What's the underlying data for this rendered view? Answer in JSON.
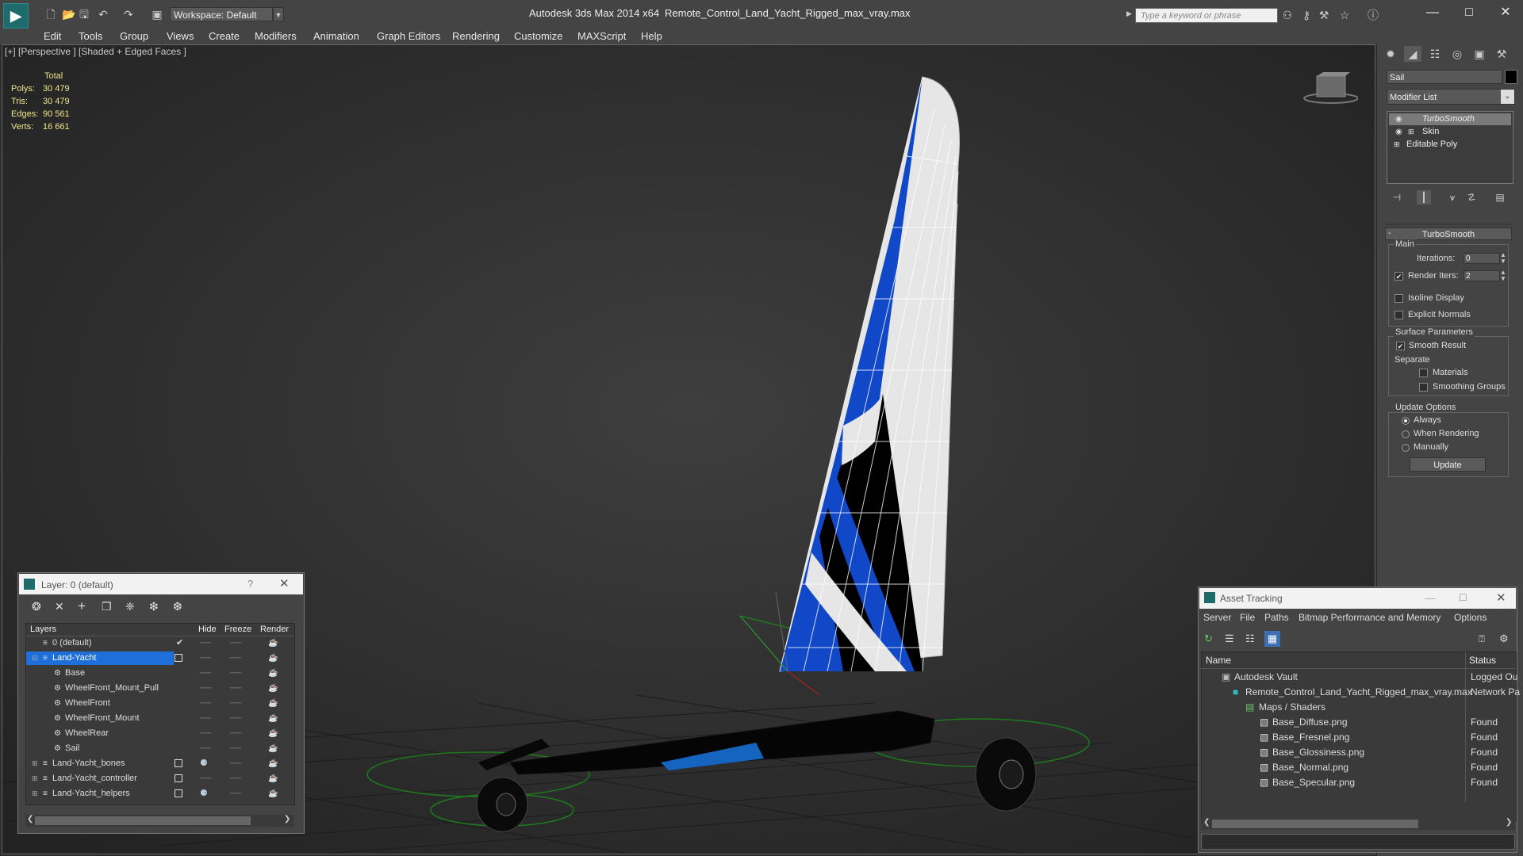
{
  "titlebar": {
    "app_title": "Autodesk 3ds Max  2014 x64",
    "file_title": "Remote_Control_Land_Yacht_Rigged_max_vray.max",
    "workspace_label": "Workspace: Default",
    "search_placeholder": "Type a keyword or phrase"
  },
  "menu": [
    "Edit",
    "Tools",
    "Group",
    "Views",
    "Create",
    "Modifiers",
    "Animation",
    "Graph Editors",
    "Rendering",
    "Customize",
    "MAXScript",
    "Help"
  ],
  "viewport": {
    "label": "[+] [Perspective ] [Shaded + Edged Faces ]",
    "stats": {
      "header": "Total",
      "rows": [
        {
          "label": "Polys:",
          "value": "30 479"
        },
        {
          "label": "Tris:",
          "value": "30 479"
        },
        {
          "label": "Edges:",
          "value": "90 561"
        },
        {
          "label": "Verts:",
          "value": "16 661"
        }
      ]
    }
  },
  "command_panel": {
    "object_name": "Sail",
    "object_color": "#000000",
    "modifier_list_label": "Modifier List",
    "stack": [
      "TurboSmooth",
      "Skin",
      "Editable Poly"
    ],
    "rollout_title": "TurboSmooth",
    "main_group": "Main",
    "iterations_label": "Iterations:",
    "iterations_value": "0",
    "render_iters_label": "Render Iters:",
    "render_iters_value": "2",
    "isoline_label": "Isoline Display",
    "explicit_normals_label": "Explicit Normals",
    "surface_params_label": "Surface Parameters",
    "smooth_result_label": "Smooth Result",
    "separate_label": "Separate",
    "materials_label": "Materials",
    "smoothing_groups_label": "Smoothing Groups",
    "update_options_label": "Update Options",
    "always_label": "Always",
    "when_rendering_label": "When Rendering",
    "manually_label": "Manually",
    "update_button": "Update"
  },
  "layer_dialog": {
    "title": "Layer: 0 (default)",
    "help": "?",
    "headers": {
      "layers": "Layers",
      "hide": "Hide",
      "freeze": "Freeze",
      "render": "Render"
    },
    "rows": [
      {
        "name": "0 (default)",
        "indent": 0
      },
      {
        "name": "Land-Yacht",
        "indent": 0
      },
      {
        "name": "Base",
        "indent": 1
      },
      {
        "name": "WheelFront_Mount_Pull",
        "indent": 1
      },
      {
        "name": "WheelFront",
        "indent": 1
      },
      {
        "name": "WheelFront_Mount",
        "indent": 1
      },
      {
        "name": "WheelRear",
        "indent": 1
      },
      {
        "name": "Sail",
        "indent": 1
      },
      {
        "name": "Land-Yacht_bones",
        "indent": 0
      },
      {
        "name": "Land-Yacht_controller",
        "indent": 0
      },
      {
        "name": "Land-Yacht_helpers",
        "indent": 0
      }
    ]
  },
  "asset_tracking": {
    "title": "Asset Tracking",
    "menu": [
      "Server",
      "File",
      "Paths",
      "Bitmap Performance and Memory",
      "Options"
    ],
    "headers": {
      "name": "Name",
      "status": "Status"
    },
    "rows": [
      {
        "name": "Autodesk Vault",
        "status": "Logged Ou"
      },
      {
        "name": "Remote_Control_Land_Yacht_Rigged_max_vray.max",
        "status": "Network Pa"
      },
      {
        "name": "Maps / Shaders",
        "status": ""
      },
      {
        "name": "Base_Diffuse.png",
        "status": "Found"
      },
      {
        "name": "Base_Fresnel.png",
        "status": "Found"
      },
      {
        "name": "Base_Glossiness.png",
        "status": "Found"
      },
      {
        "name": "Base_Normal.png",
        "status": "Found"
      },
      {
        "name": "Base_Specular.png",
        "status": "Found"
      }
    ]
  },
  "colors": {
    "accent_blue": "#1565c0",
    "selection_blue": "#1e6fd9",
    "stats_yellow": "#f0e68c"
  }
}
